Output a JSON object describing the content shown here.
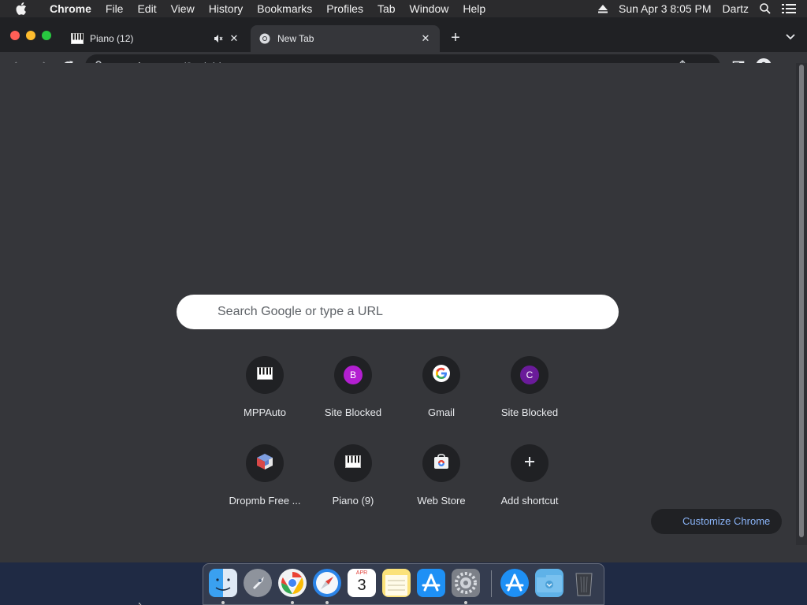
{
  "menubar": {
    "app_name": "Chrome",
    "menus": [
      "File",
      "Edit",
      "View",
      "History",
      "Bookmarks",
      "Profiles",
      "Tab",
      "Window",
      "Help"
    ],
    "datetime": "Sun Apr 3  8:05 PM",
    "user": "Dartz"
  },
  "tabs": [
    {
      "title": "Piano (12)",
      "favicon": "piano-keys-icon",
      "audio": true
    },
    {
      "title": "New Tab",
      "favicon": "chrome-icon",
      "audio": false
    }
  ],
  "omnibox": {
    "host": "mppclone.com",
    "path": "/?c=lobby"
  },
  "search": {
    "placeholder": "Search Google or type a URL"
  },
  "shortcuts": [
    {
      "label": "MPPAuto",
      "icon": "piano-keys-icon"
    },
    {
      "label": "Site Blocked",
      "icon": "letter-b-icon",
      "letter": "B",
      "color": "#b31fd1"
    },
    {
      "label": "Gmail",
      "icon": "google-g-icon"
    },
    {
      "label": "Site Blocked",
      "icon": "letter-c-icon",
      "letter": "C",
      "color": "#6a1b9a"
    },
    {
      "label": "Dropmb Free ...",
      "icon": "dropmb-cube-icon"
    },
    {
      "label": "Piano (9)",
      "icon": "piano-keys-icon"
    },
    {
      "label": "Web Store",
      "icon": "web-store-icon"
    },
    {
      "label": "Add shortcut",
      "icon": "plus-icon"
    }
  ],
  "customize": {
    "label": "Customize Chrome"
  },
  "dock": {
    "apps": [
      "finder",
      "launchpad",
      "chrome",
      "safari",
      "calendar",
      "notes",
      "app-store",
      "system-preferences",
      "app-store",
      "downloads-folder",
      "trash"
    ],
    "calendar_day": "3",
    "calendar_month": "APR"
  },
  "colors": {
    "tabstrip": "#202124",
    "toolbar": "#35363a",
    "link": "#8ab4f8"
  }
}
